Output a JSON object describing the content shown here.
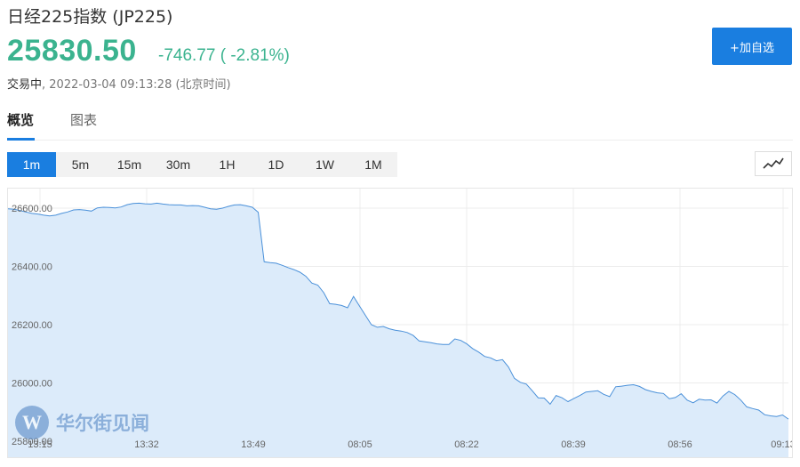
{
  "header": {
    "title": "日经225指数 (JP225)",
    "price": "25830.50",
    "change": "-746.77 ( -2.81%)",
    "status_state": "交易中",
    "status_time": ", 2022-03-04 09:13:28 (北京时间)",
    "add_button": "+加自选"
  },
  "tabs": [
    {
      "label": "概览",
      "active": true
    },
    {
      "label": "图表",
      "active": false
    }
  ],
  "periods": [
    {
      "label": "1m",
      "active": true
    },
    {
      "label": "5m",
      "active": false
    },
    {
      "label": "15m",
      "active": false
    },
    {
      "label": "30m",
      "active": false
    },
    {
      "label": "1H",
      "active": false
    },
    {
      "label": "1D",
      "active": false
    },
    {
      "label": "1W",
      "active": false
    },
    {
      "label": "1M",
      "active": false
    }
  ],
  "icons": {
    "chart_toggle": "line-chart-icon"
  },
  "watermark": {
    "logo_letter": "W",
    "brand": "华尔街见闻"
  },
  "colors": {
    "up_down_green": "#3bb38f",
    "accent_blue": "#1a7ee0",
    "line": "#4a90d9",
    "fill": "#dcebfa"
  },
  "chart_data": {
    "type": "area",
    "title": "",
    "xlabel": "",
    "ylabel": "",
    "y_tick_labels": [
      "26600.00",
      "26400.00",
      "26200.00",
      "26000.00",
      "25800.00"
    ],
    "y_ticks": [
      26600,
      26400,
      26200,
      26000,
      25800
    ],
    "ylim": [
      25780,
      26660
    ],
    "x_tick_labels": [
      "13:15",
      "13:32",
      "13:49",
      "08:05",
      "08:22",
      "08:39",
      "08:56",
      "09:13"
    ],
    "grid": true,
    "series": [
      {
        "values": [
          26598,
          26596,
          26592,
          26587,
          26582,
          26580,
          26576,
          26573,
          26576,
          26582,
          26587,
          26594,
          26595,
          26593,
          26590,
          26601,
          26603,
          26602,
          26601,
          26604,
          26612,
          26616,
          26617,
          26615,
          26614,
          26617,
          26614,
          26612,
          26611,
          26611,
          26608,
          26609,
          26608,
          26603,
          26598,
          26596,
          26600,
          26606,
          26611,
          26612,
          26608,
          26603,
          26586,
          26416,
          26413,
          26411,
          26404,
          26396,
          26389,
          26380,
          26366,
          26343,
          26336,
          26310,
          26272,
          26270,
          26266,
          26258,
          26297,
          26264,
          26232,
          26200,
          26191,
          26194,
          26186,
          26181,
          26178,
          26173,
          26163,
          26144,
          26141,
          26138,
          26134,
          26132,
          26132,
          26151,
          26146,
          26134,
          26118,
          26106,
          26091,
          26086,
          26076,
          26080,
          26055,
          26016,
          26002,
          25996,
          25973,
          25949,
          25948,
          25927,
          25957,
          25949,
          25936,
          25947,
          25957,
          25969,
          25971,
          25973,
          25961,
          25953,
          25987,
          25989,
          25992,
          25994,
          25988,
          25977,
          25971,
          25966,
          25964,
          25946,
          25950,
          25963,
          25941,
          25932,
          25944,
          25941,
          25942,
          25931,
          25955,
          25971,
          25960,
          25941,
          25918,
          25912,
          25907,
          25891,
          25887,
          25885,
          25890,
          25876
        ]
      }
    ]
  }
}
